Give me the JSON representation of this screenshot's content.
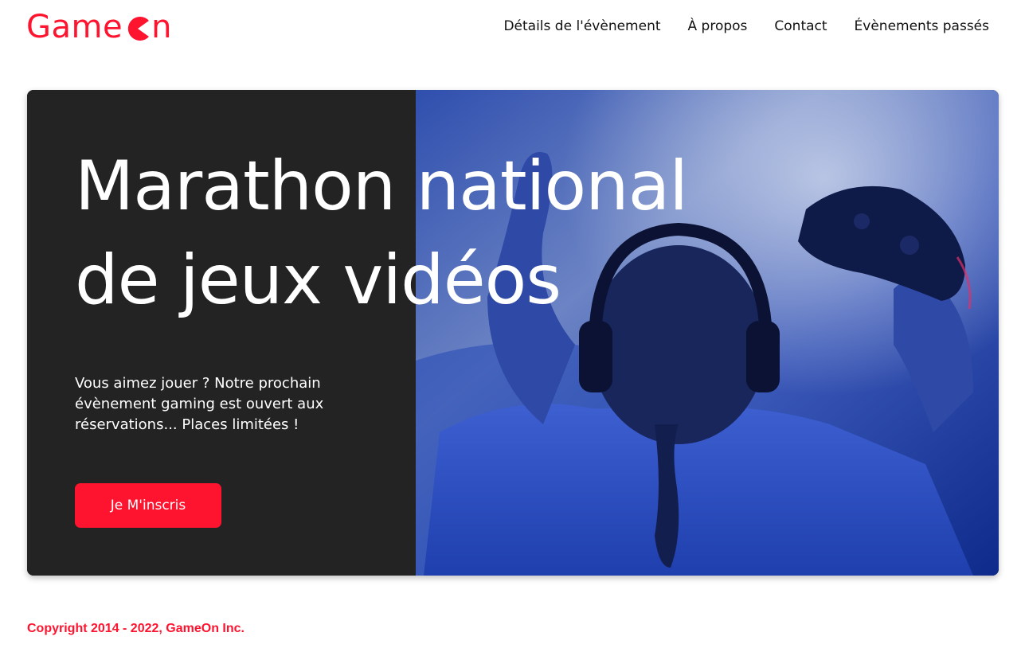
{
  "brand": {
    "logo_prefix": "Game",
    "logo_suffix": "n",
    "logo_icon": "pacman-o-icon",
    "accent_color": "#fe142f"
  },
  "nav": {
    "items": [
      {
        "label": "Détails de l'évènement"
      },
      {
        "label": "À propos"
      },
      {
        "label": "Contact"
      },
      {
        "label": "Évènements passés"
      }
    ]
  },
  "hero": {
    "title_line1": "Marathon national",
    "title_line2": "de jeux vidéos",
    "description": "Vous aimez jouer ? Notre prochain évènement gaming est ouvert aux réservations... Places limitées !",
    "cta_label": "Je M'inscris",
    "panel_color": "#232323"
  },
  "footer": {
    "copyright": "Copyright 2014 - 2022, GameOn Inc."
  }
}
